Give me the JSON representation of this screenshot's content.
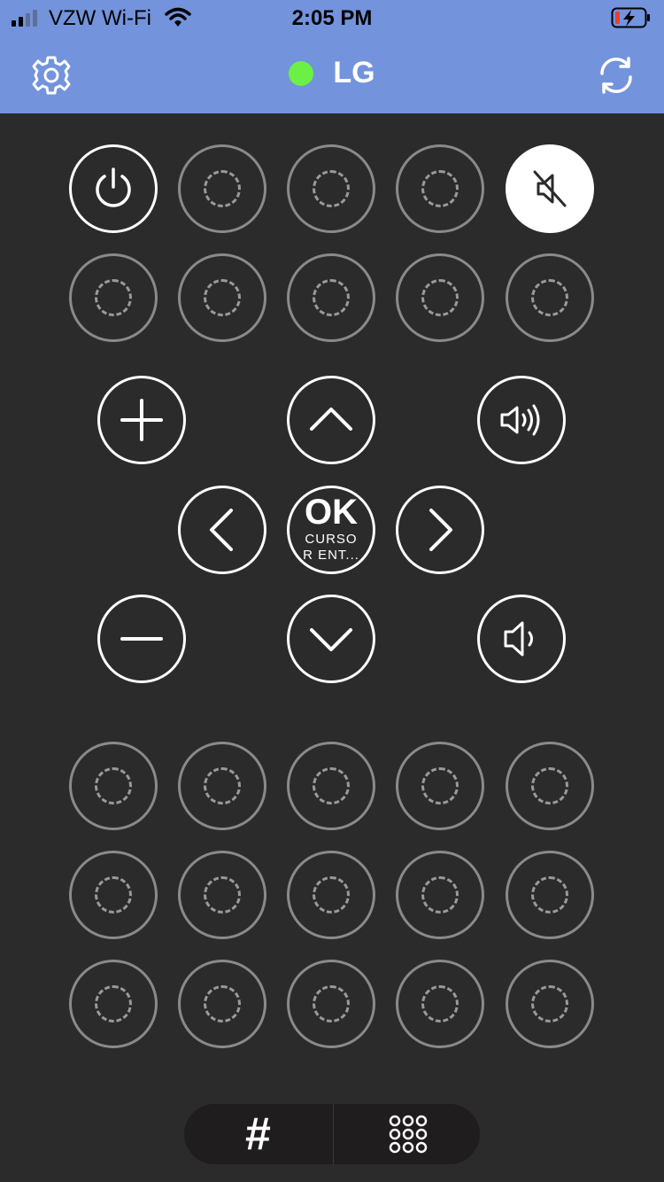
{
  "status_bar": {
    "carrier": "VZW Wi-Fi",
    "time": "2:05 PM"
  },
  "header": {
    "title": "LG",
    "connection_color": "#6cf046",
    "icons": [
      "gear-icon",
      "refresh-icon"
    ]
  },
  "remote": {
    "ok_label": "OK",
    "ok_sublabel_line1": "CURSO",
    "ok_sublabel_line2": "R ENT...",
    "icons": [
      "power-icon",
      "mute-icon",
      "plus-icon",
      "up-arrow-icon",
      "volume-up-icon",
      "left-arrow-icon",
      "right-arrow-icon",
      "minus-icon",
      "down-arrow-icon",
      "volume-down-icon"
    ]
  },
  "bottom_bar": {
    "left_label": "#",
    "right_icon": "keypad-icon"
  },
  "colors": {
    "header_bg": "#7393dc",
    "body_bg": "#2b2b2b",
    "bar_bg": "#1f1d1d"
  }
}
